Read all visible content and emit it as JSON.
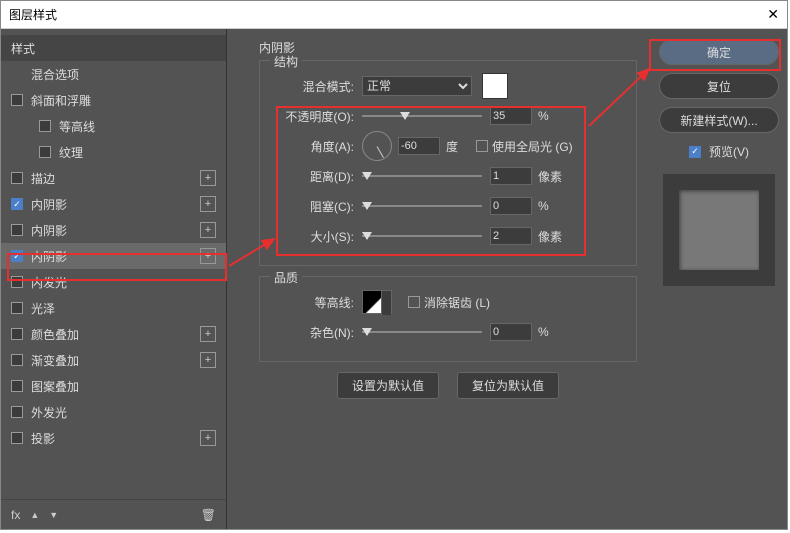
{
  "dialog_title": "图层样式",
  "close_glyph": "✕",
  "sidebar": {
    "header": "样式",
    "items": [
      {
        "label": "混合选项",
        "checked": null,
        "indent": false,
        "plus": false,
        "active": false
      },
      {
        "label": "斜面和浮雕",
        "checked": false,
        "indent": false,
        "plus": false,
        "active": false
      },
      {
        "label": "等高线",
        "checked": false,
        "indent": true,
        "plus": false,
        "active": false
      },
      {
        "label": "纹理",
        "checked": false,
        "indent": true,
        "plus": false,
        "active": false
      },
      {
        "label": "描边",
        "checked": false,
        "indent": false,
        "plus": true,
        "active": false
      },
      {
        "label": "内阴影",
        "checked": true,
        "indent": false,
        "plus": true,
        "active": false
      },
      {
        "label": "内阴影",
        "checked": false,
        "indent": false,
        "plus": true,
        "active": false
      },
      {
        "label": "内阴影",
        "checked": true,
        "indent": false,
        "plus": true,
        "active": true
      },
      {
        "label": "内发光",
        "checked": false,
        "indent": false,
        "plus": false,
        "active": false
      },
      {
        "label": "光泽",
        "checked": false,
        "indent": false,
        "plus": false,
        "active": false
      },
      {
        "label": "颜色叠加",
        "checked": false,
        "indent": false,
        "plus": true,
        "active": false
      },
      {
        "label": "渐变叠加",
        "checked": false,
        "indent": false,
        "plus": true,
        "active": false
      },
      {
        "label": "图案叠加",
        "checked": false,
        "indent": false,
        "plus": false,
        "active": false
      },
      {
        "label": "外发光",
        "checked": false,
        "indent": false,
        "plus": false,
        "active": false
      },
      {
        "label": "投影",
        "checked": false,
        "indent": false,
        "plus": true,
        "active": false
      }
    ],
    "footer": {
      "fx": "fx",
      "up": "▲",
      "down": "▼",
      "trash": "🗑"
    }
  },
  "main": {
    "title": "内阴影",
    "structure_label": "结构",
    "blend_mode_label": "混合模式:",
    "blend_mode_value": "正常",
    "opacity_label": "不透明度(O):",
    "opacity_value": "35",
    "opacity_unit": "%",
    "angle_label": "角度(A):",
    "angle_value": "-60",
    "angle_unit": "度",
    "global_light": "使用全局光 (G)",
    "distance_label": "距离(D):",
    "distance_value": "1",
    "distance_unit": "像素",
    "choke_label": "阻塞(C):",
    "choke_value": "0",
    "choke_unit": "%",
    "size_label": "大小(S):",
    "size_value": "2",
    "size_unit": "像素",
    "quality_label": "品质",
    "contour_label": "等高线:",
    "antialias": "消除锯齿 (L)",
    "noise_label": "杂色(N):",
    "noise_value": "0",
    "noise_unit": "%",
    "set_default": "设置为默认值",
    "reset_default": "复位为默认值"
  },
  "right": {
    "ok": "确定",
    "cancel": "复位",
    "new_style": "新建样式(W)...",
    "preview": "预览(V)"
  }
}
